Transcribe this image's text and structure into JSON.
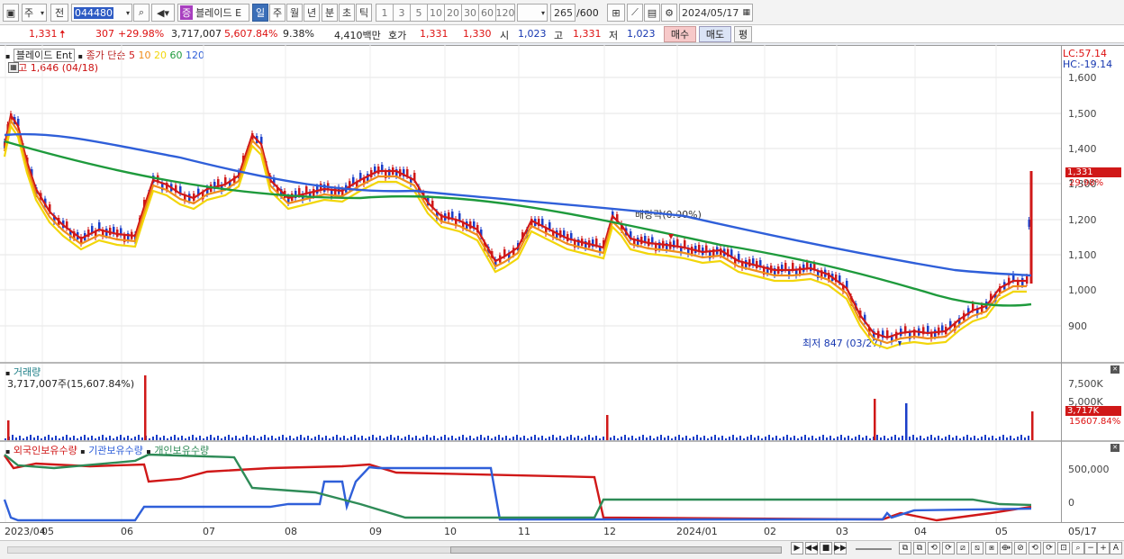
{
  "toolbar": {
    "market_select": "주",
    "prev_label": "전",
    "stock_code": "044480",
    "stock_badge": "증",
    "stock_name": "블레이드 E",
    "period_tabs": [
      "일",
      "주",
      "월",
      "년",
      "분",
      "초",
      "틱"
    ],
    "tick_nums": [
      "1",
      "3",
      "5",
      "10",
      "20",
      "30",
      "60",
      "120"
    ],
    "count_value": "265",
    "count_total": "/600",
    "date_value": "2024/05/17"
  },
  "quote": {
    "price": "1,331",
    "change": "307",
    "change_pct": "+29.98%",
    "volume": "3,717,007",
    "volume_pct": "5,607.84%",
    "turnover": "9.38%",
    "amount": "4,410백만",
    "hoga_label": "호가",
    "ask": "1,331",
    "bid": "1,330",
    "open_label": "시",
    "open": "1,023",
    "high_label": "고",
    "high": "1,331",
    "low_label": "저",
    "low": "1,023",
    "buy_label": "매수",
    "sell_label": "매도",
    "eval_label": "평"
  },
  "price_panel": {
    "legend_name": "블레이드 Ent",
    "legend_ma": "종가 단순",
    "ma_periods": [
      {
        "label": "5",
        "color": "#d01818"
      },
      {
        "label": "10",
        "color": "#f08c1a"
      },
      {
        "label": "20",
        "color": "#f2d60a"
      },
      {
        "label": "60",
        "color": "#1e9a3c"
      },
      {
        "label": "120",
        "color": "#2f5fd9"
      }
    ],
    "high_marker": "최고 1,646 (04/18)",
    "low_marker": "최저 847 (03/27)",
    "dividend_marker": "배당락(0.00%)",
    "lc": "LC:57.14",
    "hc": "HC:-19.14",
    "price_tag": "1,331",
    "pct_tag": "29.98%",
    "y_ticks": [
      "1,600",
      "1,500",
      "1,400",
      "1,300",
      "1,200",
      "1,100",
      "1,000",
      "900"
    ]
  },
  "volume_panel": {
    "title": "거래량",
    "value": "3,717,007주(15,607.84%)",
    "y_ticks": [
      "7,500K",
      "5,000K"
    ],
    "tag_value": "3,717K",
    "tag_pct": "15607.84%"
  },
  "holding_panel": {
    "series": [
      {
        "name": "외국인보유수량",
        "color": "#d01818"
      },
      {
        "name": "기관보유수량",
        "color": "#2f5fd9"
      },
      {
        "name": "개인보유수량",
        "color": "#2e8b57"
      }
    ],
    "y_ticks": [
      "500,000",
      "0"
    ]
  },
  "x_axis": {
    "labels": [
      "2023/04",
      "05",
      "06",
      "07",
      "08",
      "09",
      "10",
      "11",
      "12",
      "2024/01",
      "02",
      "03",
      "04",
      "05"
    ],
    "right_label": "05/17"
  }
}
